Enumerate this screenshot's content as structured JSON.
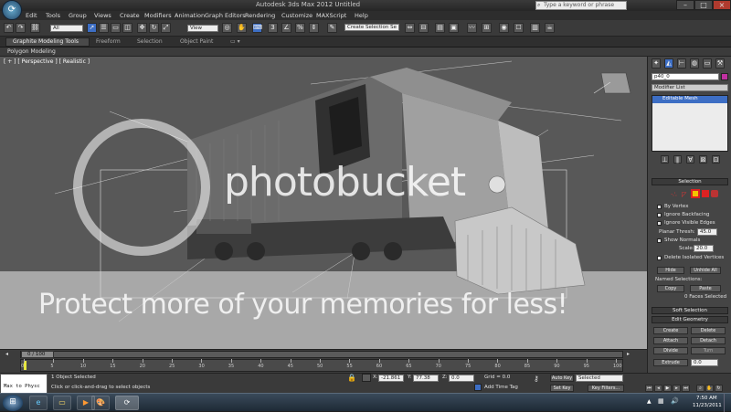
{
  "title_bar": {
    "title": "Autodesk 3ds Max 2012     Untitled",
    "search_placeholder": "Type a keyword or phrase"
  },
  "menu": [
    "Edit",
    "Tools",
    "Group",
    "Views",
    "Create",
    "Modifiers",
    "Animation",
    "Graph Editors",
    "Rendering",
    "Customize",
    "MAXScript",
    "Help"
  ],
  "toolbar": {
    "selection_filter": "All",
    "reference_coord": "View",
    "named_selection": "Create Selection Se"
  },
  "ribbon_tabs": [
    "Graphite Modeling Tools",
    "Freeform",
    "Selection",
    "Object Paint"
  ],
  "ribbon_panel": "Polygon Modeling",
  "viewport": {
    "label": "[ + ] [ Perspective ] [ Realistic ]",
    "watermark_brand": "photobucket",
    "watermark_slogan": "Protect more of your memories for less!"
  },
  "command_panel": {
    "object_name": "p40_0",
    "modifier_list": "Modifier List",
    "stack_item": "Editable Mesh",
    "selection_rollout": "Selection",
    "by_vertex": "By Vertex",
    "ignore_backfacing": "Ignore Backfacing",
    "ignore_visible_edges": "Ignore Visible Edges",
    "planar_thresh_label": "Planar Thresh:",
    "planar_thresh_value": "45.0",
    "show_normals": "Show Normals",
    "scale_label": "Scale:",
    "scale_value": "20.0",
    "delete_isolated": "Delete Isolated Vertices",
    "hide": "Hide",
    "unhide_all": "Unhide All",
    "named_selections": "Named Selections:",
    "copy": "Copy",
    "paste": "Paste",
    "faces_selected": "0 Faces Selected",
    "soft_selection": "Soft Selection",
    "edit_geometry": "Edit Geometry",
    "create": "Create",
    "delete": "Delete",
    "attach": "Attach",
    "detach": "Detach",
    "divide": "Divide",
    "turn": "Turn",
    "extrude": "Extrude",
    "extrude_value": "0.0"
  },
  "timeline": {
    "frame": "0 / 100",
    "ticks": [
      "0",
      "5",
      "10",
      "15",
      "20",
      "25",
      "30",
      "35",
      "40",
      "45",
      "50",
      "55",
      "60",
      "65",
      "70",
      "75",
      "80",
      "85",
      "90",
      "95",
      "100"
    ]
  },
  "status": {
    "maxscript": "Max to Physc",
    "objects_selected": "1 Object Selected",
    "prompt": "Click or click-and-drag to select objects",
    "x_label": "X:",
    "x_value": "-21.861",
    "y_label": "Y:",
    "y_value": "77.38",
    "z_label": "Z:",
    "z_value": "0.0",
    "grid": "Grid = 0.0",
    "add_time_tag": "Add Time Tag",
    "auto_key": "Auto Key",
    "selected": "Selected",
    "set_key": "Set Key",
    "key_filters": "Key Filters..."
  },
  "taskbar": {
    "time": "7:50 AM",
    "date": "11/23/2011"
  },
  "colors": {
    "viewport_bg": "#a3a3a3",
    "panel_bg": "#454545",
    "highlight_blue": "#3d6ec4",
    "selection_yellow": "#f2c500"
  }
}
